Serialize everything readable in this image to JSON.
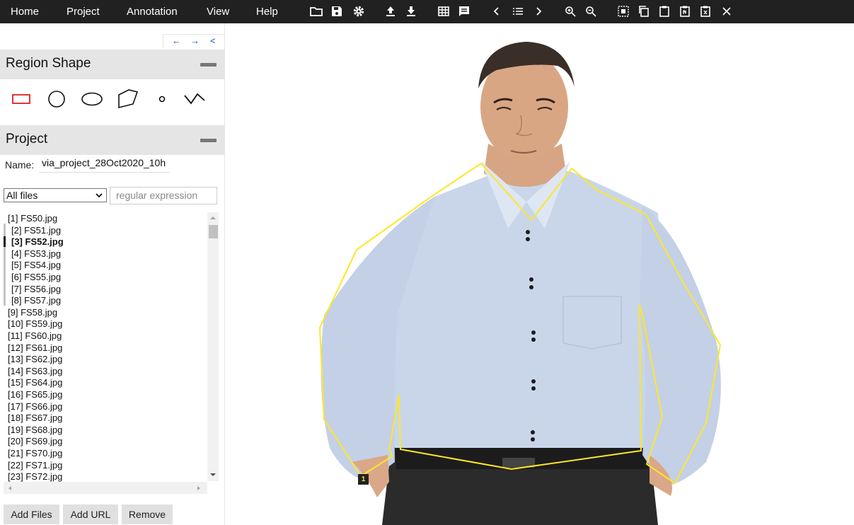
{
  "menu": {
    "home": "Home",
    "project": "Project",
    "annotation": "Annotation",
    "view": "View",
    "help": "Help"
  },
  "toolbar_icons": [
    "folder-icon",
    "save-icon",
    "gear-icon",
    "upload-icon",
    "download-icon",
    "grid-icon",
    "comment-icon",
    "prev-icon",
    "list-icon",
    "next-icon",
    "zoom-in-icon",
    "zoom-out-icon",
    "select-all-icon",
    "copy-icon",
    "paste-icon",
    "paste-n-icon",
    "paste-x-icon",
    "close-icon"
  ],
  "nav": {
    "left": "←",
    "right": "→",
    "extra": "˂"
  },
  "region_shape": {
    "title": "Region Shape",
    "shapes": [
      "rectangle",
      "circle",
      "ellipse",
      "polygon",
      "point",
      "polyline"
    ],
    "active_color": "#e02020"
  },
  "project": {
    "title": "Project",
    "name_label": "Name:",
    "name_value": "via_project_28Oct2020_10h",
    "filter_value": "All files",
    "regex_placeholder": "regular expression",
    "files": [
      "[1] FS50.jpg",
      "[2] FS51.jpg",
      "[3] FS52.jpg",
      "[4] FS53.jpg",
      "[5] FS54.jpg",
      "[6] FS55.jpg",
      "[7] FS56.jpg",
      "[8] FS57.jpg",
      "[9] FS58.jpg",
      "[10] FS59.jpg",
      "[11] FS60.jpg",
      "[12] FS61.jpg",
      "[13] FS62.jpg",
      "[14] FS63.jpg",
      "[15] FS64.jpg",
      "[16] FS65.jpg",
      "[17] FS66.jpg",
      "[18] FS67.jpg",
      "[19] FS68.jpg",
      "[20] FS69.jpg",
      "[21] FS70.jpg",
      "[22] FS71.jpg",
      "[23] FS72.jpg"
    ],
    "current_index": 2,
    "buttons": {
      "add_files": "Add Files",
      "add_url": "Add URL",
      "remove": "Remove"
    }
  },
  "canvas": {
    "region_id": "1",
    "region_color": "#ffe629",
    "shirt_color": "#c9d6ea",
    "trouser_color": "#2b2b2b"
  }
}
